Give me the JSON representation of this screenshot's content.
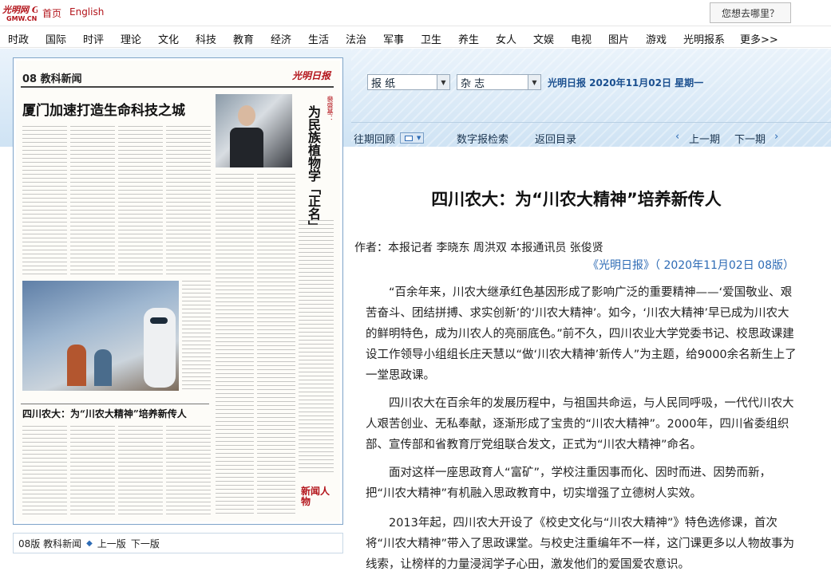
{
  "topbar": {
    "logo_text": "光明网 GMW.CN",
    "home": "首页",
    "english": "English",
    "where": "您想去哪里？"
  },
  "nav": [
    "时政",
    "国际",
    "时评",
    "理论",
    "文化",
    "科技",
    "教育",
    "经济",
    "生活",
    "法治",
    "军事",
    "卫生",
    "养生",
    "女人",
    "文娱",
    "电视",
    "图片",
    "游戏",
    "光明报系",
    "更多>>"
  ],
  "paper": {
    "section_head": "08 教科新闻",
    "brand": "光明日报",
    "headline": "厦门加速打造生命科技之城",
    "vertical_headline": "为民族植物学「正名」",
    "vertical_sub": "裴盛基：",
    "headline2": "四川农大：为“川农大精神”培养新传人",
    "corner": "新闻人物"
  },
  "pager": {
    "label": "08版 教科新闻",
    "prev": "上一版",
    "next": "下一版"
  },
  "selectors": {
    "newspaper": "报 纸",
    "magazine": "杂 志"
  },
  "paper_info": "光明日报  2020年11月02日  星期一",
  "toolbar": {
    "back_review": "往期回顾",
    "digital_search": "数字报检索",
    "back_to_list": "返回目录",
    "prev_issue": "上一期",
    "next_issue": "下一期"
  },
  "article": {
    "title": "四川农大：为“川农大精神”培养新传人",
    "authors": "作者：本报记者  李晓东  周洪双  本报通讯员  张俊贤",
    "source": "《光明日报》（ 2020年11月02日  08版）",
    "paragraphs": [
      "“百余年来，川农大继承红色基因形成了影响广泛的重要精神——‘爱国敬业、艰苦奋斗、团结拼搏、求实创新’的‘川农大精神’。如今，‘川农大精神’早已成为川农大的鲜明特色，成为川农人的亮丽底色。”前不久，四川农业大学党委书记、校思政课建设工作领导小组组长庄天慧以“做‘川农大精神’新传人”为主题，给9000余名新生上了一堂思政课。",
      "四川农大在百余年的发展历程中，与祖国共命运，与人民同呼吸，一代代川农大人艰苦创业、无私奉献，逐渐形成了宝贵的“川农大精神”。2000年，四川省委组织部、宣传部和省教育厅党组联合发文，正式为“川农大精神”命名。",
      "面对这样一座思政育人“富矿”，学校注重因事而化、因时而进、因势而新，把“川农大精神”有机融入思政教育中，切实增强了立德树人实效。",
      "2013年起，四川农大开设了《校史文化与“川农大精神”》特色选修课，首次将“川农大精神”带入了思政课堂。与校史注重编年不一样，这门课更多以人物故事为线索，让榜样的力量浸润学子心田，激发他们的爱国爱农意识。"
    ]
  },
  "colors": {
    "brand_red": "#b3141b",
    "link_blue": "#2d6bb5",
    "band_blue": "#cfe3f4"
  }
}
